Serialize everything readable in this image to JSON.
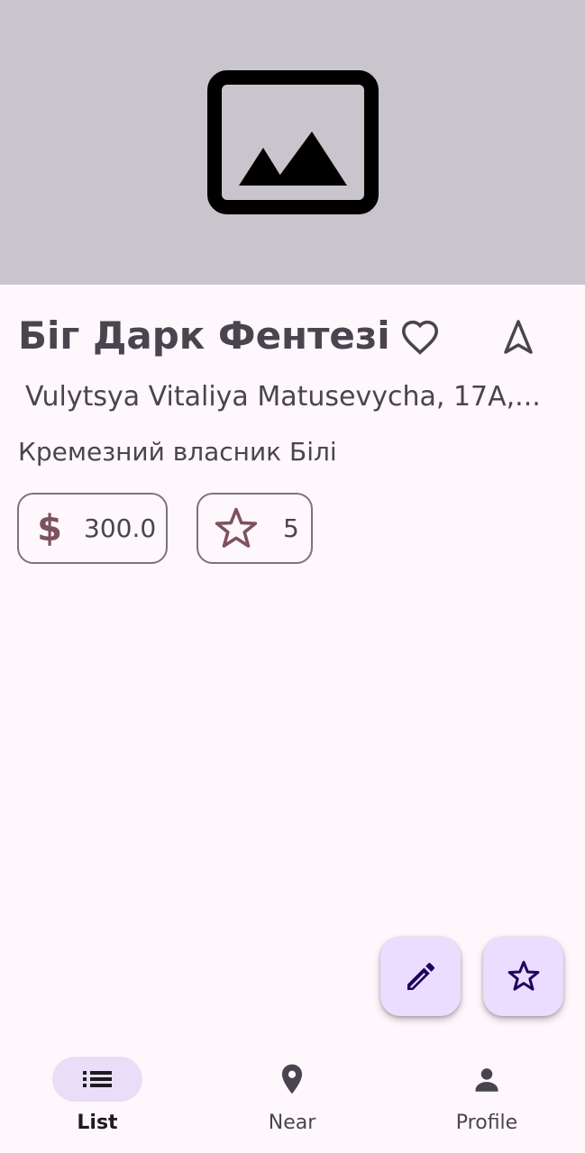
{
  "place": {
    "title": "Біг Дарк Фентезі",
    "address": "Vulytsya Vitaliya Matusevycha, 17A,...",
    "description": "Кремезний власник Білі",
    "price_icon": "$",
    "price": "300.0",
    "rating": "5"
  },
  "icons": {
    "hero": "image-placeholder-icon",
    "favorite": "heart-outline-icon",
    "navigate": "navigation-arrow-icon",
    "rating": "star-outline-icon",
    "edit_fab": "pencil-icon",
    "star_fab": "star-outline-icon"
  },
  "bottom_nav": {
    "items": [
      {
        "label": "List",
        "icon": "list-icon",
        "active": true
      },
      {
        "label": "Near",
        "icon": "location-pin-icon",
        "active": false
      },
      {
        "label": "Profile",
        "icon": "person-icon",
        "active": false
      }
    ]
  },
  "colors": {
    "background": "#fef7fc",
    "hero_bg": "#cac5cc",
    "text": "#49454f",
    "accent": "#7d5260",
    "fab_bg": "#eaddff",
    "fab_icon": "#21005d",
    "nav_active_pill": "#e8def8"
  }
}
